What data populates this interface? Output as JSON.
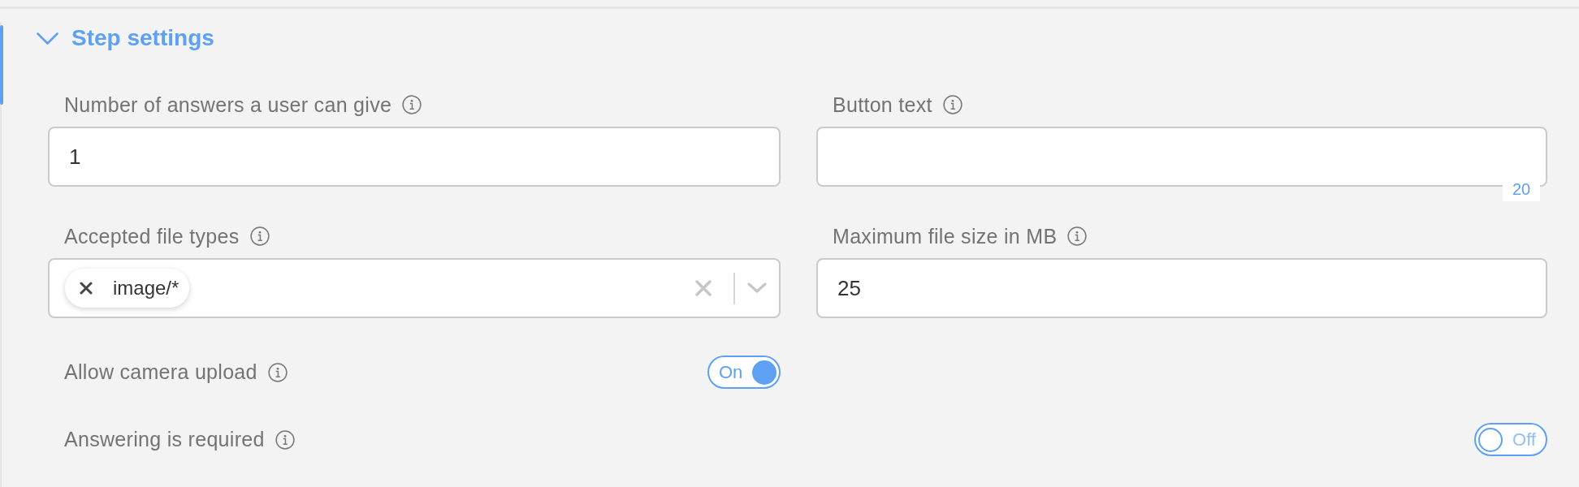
{
  "section": {
    "title": "Step settings",
    "expanded": true
  },
  "fields": [
    {
      "kind": "text",
      "label": "Number of answers a user can give",
      "value": "1"
    },
    {
      "kind": "text",
      "label": "Button text",
      "counter": "20"
    },
    {
      "kind": "multiselect",
      "label": "Accepted file types",
      "chips": [
        {
          "label": "image/*"
        }
      ]
    },
    {
      "kind": "text",
      "label": "Maximum file size in MB",
      "value": "25"
    },
    {
      "kind": "toggle",
      "label": "Allow camera upload",
      "on": true,
      "state_text": "On"
    }
  ],
  "toggles": [
    {
      "label": "Answering is required",
      "on": false,
      "state_text": "Off"
    }
  ]
}
